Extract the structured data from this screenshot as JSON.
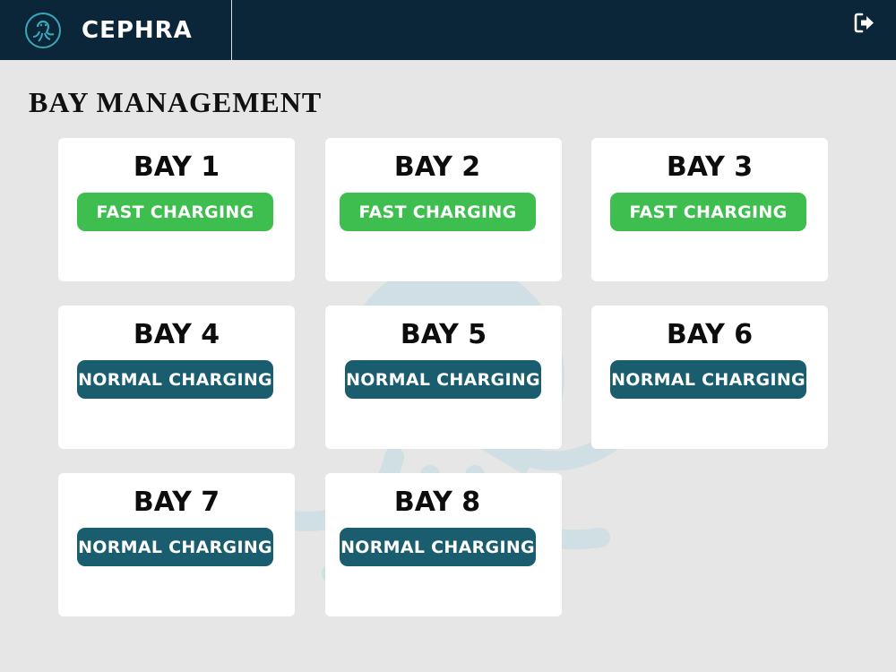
{
  "brand": {
    "name": "CEPHRA",
    "logo_icon": "octopus-plug-icon",
    "logout_icon": "logout-icon"
  },
  "page": {
    "title": "BAY MANAGEMENT"
  },
  "colors": {
    "header": "#0b2638",
    "fast": "#3dbe4f",
    "normal": "#1a5d6e",
    "background": "#e6e6e6"
  },
  "bays": [
    {
      "title": "BAY 1",
      "mode": "FAST CHARGING"
    },
    {
      "title": "BAY 2",
      "mode": "FAST CHARGING"
    },
    {
      "title": "BAY 3",
      "mode": "FAST CHARGING"
    },
    {
      "title": "BAY 4",
      "mode": "NORMAL CHARGING"
    },
    {
      "title": "BAY 5",
      "mode": "NORMAL CHARGING"
    },
    {
      "title": "BAY 6",
      "mode": "NORMAL CHARGING"
    },
    {
      "title": "BAY 7",
      "mode": "NORMAL CHARGING"
    },
    {
      "title": "BAY 8",
      "mode": "NORMAL CHARGING"
    }
  ]
}
